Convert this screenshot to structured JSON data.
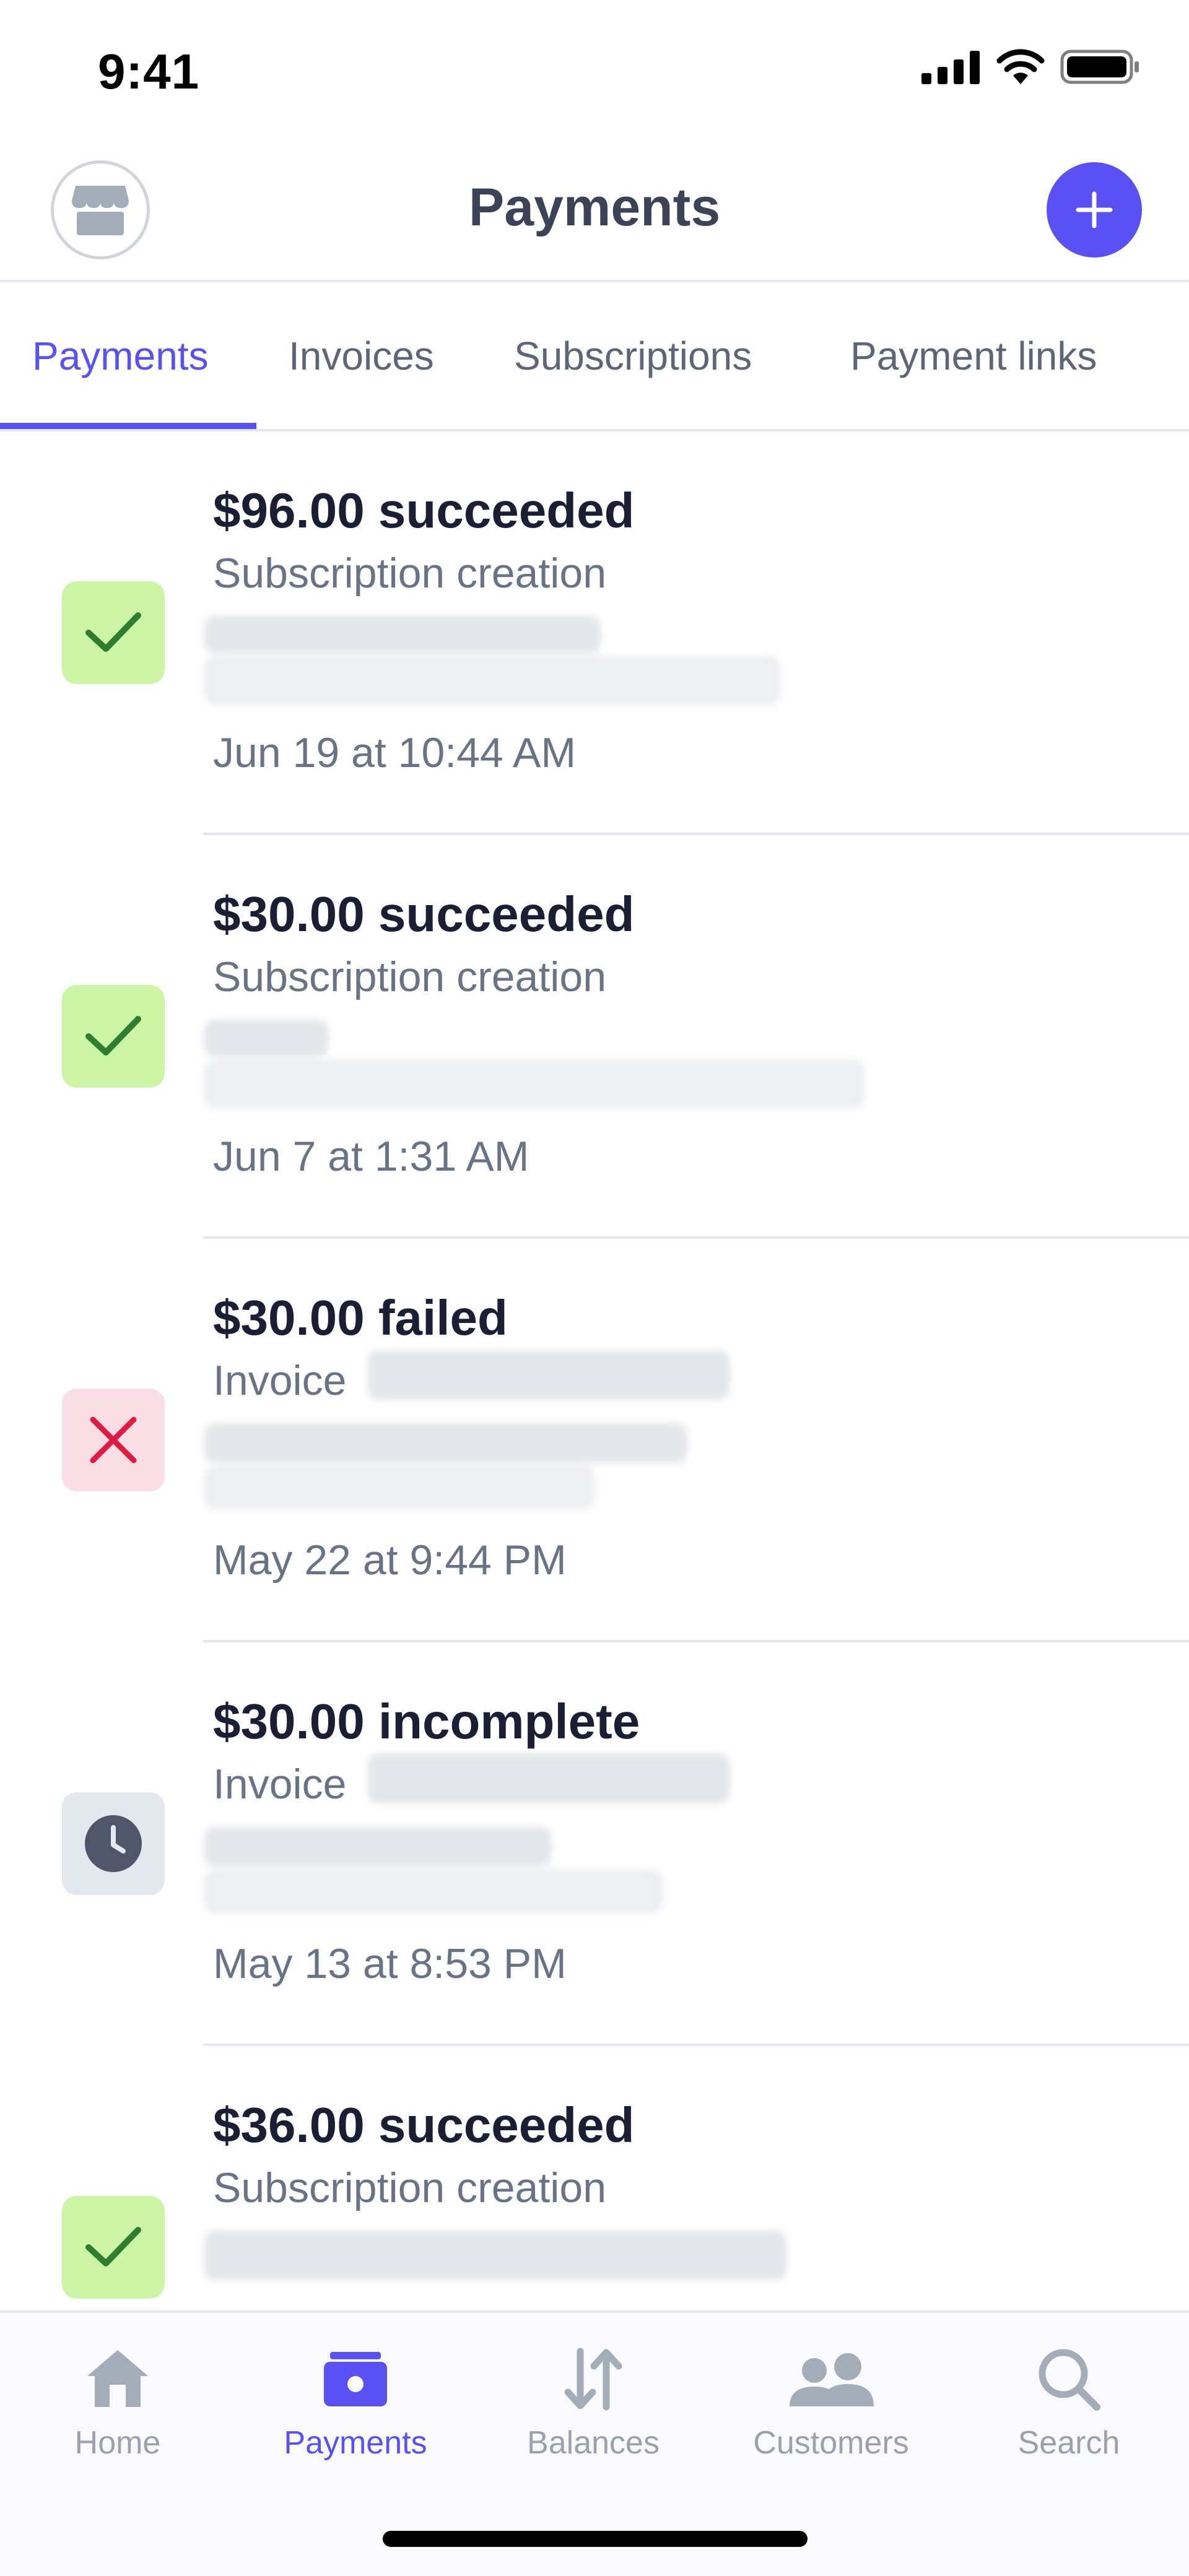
{
  "status_bar": {
    "time": "9:41"
  },
  "header": {
    "title": "Payments"
  },
  "tabs": [
    {
      "label": "Payments",
      "active": true
    },
    {
      "label": "Invoices",
      "active": false
    },
    {
      "label": "Subscriptions",
      "active": false
    },
    {
      "label": "Payment links",
      "active": false
    }
  ],
  "payments": [
    {
      "amount": "$96.00 succeeded",
      "description": "Subscription creation",
      "date": "Jun 19 at 10:44 AM",
      "status": "succeeded",
      "icon": "check-icon"
    },
    {
      "amount": "$30.00 succeeded",
      "description": "Subscription creation",
      "date": "Jun 7 at 1:31 AM",
      "status": "succeeded",
      "icon": "check-icon"
    },
    {
      "amount": "$30.00 failed",
      "description": "Invoice",
      "date": "May 22 at 9:44 PM",
      "status": "failed",
      "icon": "x-icon"
    },
    {
      "amount": "$30.00 incomplete",
      "description": "Invoice",
      "date": "May 13 at 8:53 PM",
      "status": "incomplete",
      "icon": "clock-icon"
    },
    {
      "amount": "$36.00 succeeded",
      "description": "Subscription creation",
      "date": "",
      "status": "succeeded",
      "icon": "check-icon"
    }
  ],
  "bottom_nav": [
    {
      "label": "Home",
      "icon": "home-icon",
      "active": false
    },
    {
      "label": "Payments",
      "icon": "payments-icon",
      "active": true
    },
    {
      "label": "Balances",
      "icon": "balances-icon",
      "active": false
    },
    {
      "label": "Customers",
      "icon": "customers-icon",
      "active": false
    },
    {
      "label": "Search",
      "icon": "search-icon",
      "active": false
    }
  ],
  "colors": {
    "accent": "#5a51f2",
    "success_bg": "#cbf5a5",
    "success_fg": "#2e7d32",
    "failed_bg": "#fbdde6",
    "failed_fg": "#df1b41",
    "pending_bg": "#e3e8ee",
    "pending_fg": "#4f566b"
  }
}
